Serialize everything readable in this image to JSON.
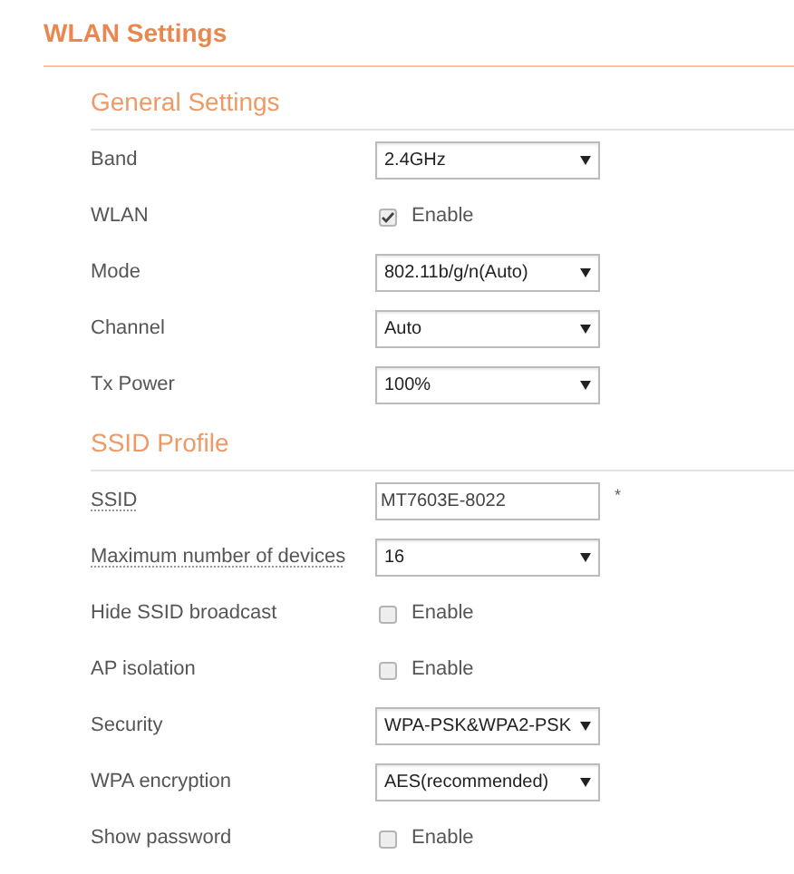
{
  "page_title": "WLAN Settings",
  "sections": [
    {
      "title": "General Settings",
      "rows": [
        {
          "label": "Band",
          "kind": "select",
          "value": "2.4GHz"
        },
        {
          "label": "WLAN",
          "kind": "checkbox",
          "text": "Enable",
          "checked": true
        },
        {
          "label": "Mode",
          "kind": "select",
          "value": "802.11b/g/n(Auto)"
        },
        {
          "label": "Channel",
          "kind": "select",
          "value": "Auto"
        },
        {
          "label": "Tx Power",
          "kind": "select",
          "value": "100%"
        }
      ]
    },
    {
      "title": "SSID Profile",
      "rows": [
        {
          "label": "SSID",
          "kind": "text",
          "value": "MT7603E-8022",
          "hint": true,
          "required_mark": "*"
        },
        {
          "label": "Maximum number of devices",
          "kind": "select",
          "value": "16",
          "hint": true
        },
        {
          "label": "Hide SSID broadcast",
          "kind": "checkbox",
          "text": "Enable",
          "checked": false
        },
        {
          "label": "AP isolation",
          "kind": "checkbox",
          "text": "Enable",
          "checked": false
        },
        {
          "label": "Security",
          "kind": "select",
          "value": "WPA-PSK&WPA2-PSK"
        },
        {
          "label": "WPA encryption",
          "kind": "select",
          "value": "AES(recommended)"
        },
        {
          "label": "Show password",
          "kind": "checkbox",
          "text": "Enable",
          "checked": false
        }
      ]
    }
  ]
}
